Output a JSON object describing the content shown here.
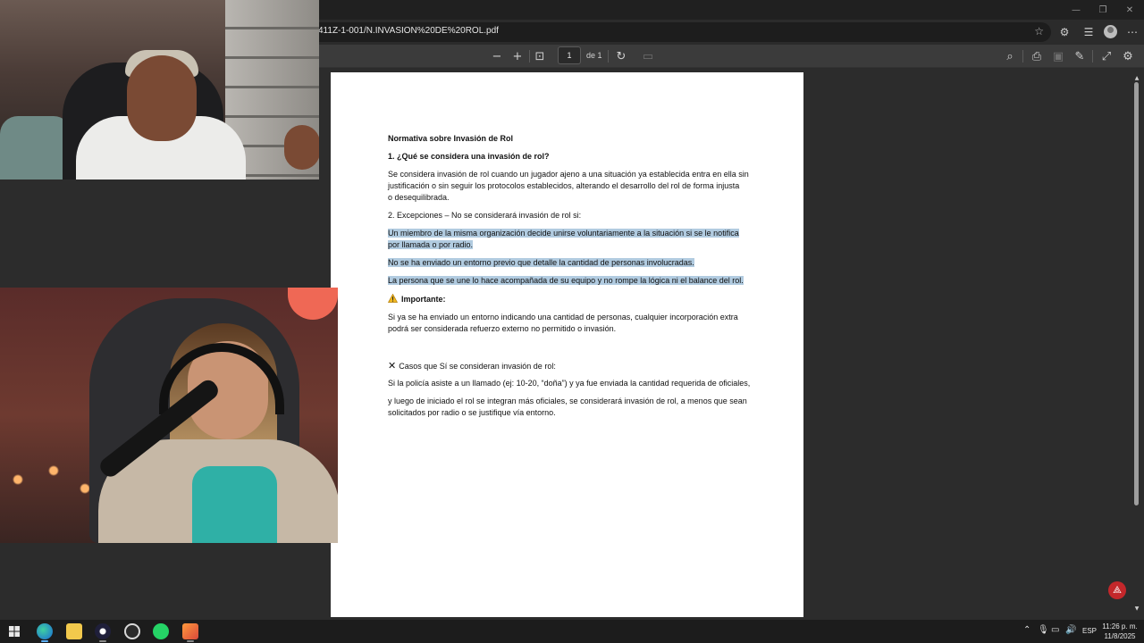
{
  "browser": {
    "url": "411Z-1-001/N.INVASION%20DE%20ROL.pdf",
    "window_controls": {
      "minimize": "—",
      "restore": "❐",
      "close": "✕"
    }
  },
  "pdf_toolbar": {
    "zoom_out": "−",
    "zoom_in": "+",
    "page_current": "1",
    "page_of": "de 1"
  },
  "document": {
    "title": "Normativa sobre Invasión de Rol",
    "q1_heading": "1. ¿Qué se considera una invasión de rol?",
    "q1_lines": [
      " Se considera invasión de rol cuando un jugador ajeno a una situación ya establecida entra en ella sin",
      "justificación o sin seguir los protocolos establecidos, alterando el desarrollo del rol de forma injusta",
      "o desequilibrada."
    ],
    "exceptions_heading": "2. Excepciones – No se considerará invasión de rol si:",
    "exception_1": [
      "Un miembro de la misma organización decide unirse voluntariamente a la situación  si se le notifica",
      "por llamada o por radio."
    ],
    "exception_2": "No se ha enviado un entorno previo que detalle la cantidad de personas involucradas.",
    "exception_3": "La persona que se une lo hace acompañada de su equipo y no rompe la lógica ni el balance del rol.",
    "important_heading": "Importante:",
    "important_lines": [
      " Si ya se ha enviado un entorno indicando una cantidad de personas, cualquier incorporación extra",
      "podrá ser considerada refuerzo externo no permitido o invasión."
    ],
    "cases_heading": "Casos que Sí se consideran invasión de rol:",
    "case_1": "Si la policía asiste a un llamado (ej: 10-20, “doña”) y ya fue enviada la cantidad requerida de oficiales,",
    "case_2_lines": [
      " y luego de iniciado el rol se integran más oficiales, se considerará invasión de rol, a menos que sean",
      "solicitados por radio o se justifique vía entorno."
    ]
  },
  "taskbar": {
    "language": "ESP",
    "time": "11:26 p. m.",
    "date": "11/8/2025"
  },
  "colors": {
    "highlight": "#b1cbe0",
    "toolbar": "#3b3b3b",
    "viewer_bg": "#2c2c2c",
    "acrobat_red": "#c3272b"
  }
}
